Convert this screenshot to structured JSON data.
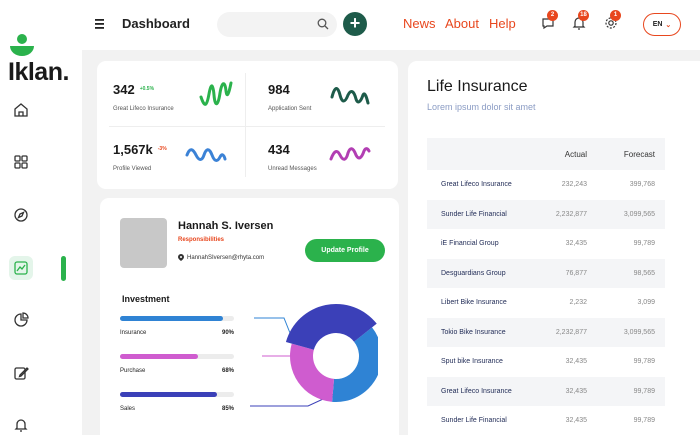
{
  "brand": {
    "name": "Iklan."
  },
  "header": {
    "title": "Dashboard",
    "links": [
      "News",
      "About",
      "Help"
    ],
    "notifications": [
      {
        "icon": "chat-icon",
        "count": "2"
      },
      {
        "icon": "bell-icon",
        "count": "18"
      },
      {
        "icon": "gear-icon",
        "count": "1"
      }
    ],
    "language": "EN"
  },
  "sidebar": {
    "items": [
      {
        "icon": "home-icon"
      },
      {
        "icon": "apps-icon"
      },
      {
        "icon": "compass-icon"
      },
      {
        "icon": "chart-icon",
        "active": true
      },
      {
        "icon": "pie-chart-icon"
      },
      {
        "icon": "edit-icon"
      },
      {
        "icon": "bell-icon"
      }
    ]
  },
  "stats": [
    {
      "value": "342",
      "change": "+0.5%",
      "change_color": "#2bb24c",
      "label": "Great Lifeco Insurance",
      "wave_color": "#2bb24c"
    },
    {
      "value": "984",
      "label": "Application Sent",
      "wave_color": "#1e5b4a"
    },
    {
      "value": "1,567k",
      "change": "-3%",
      "change_color": "#e8471e",
      "label": "Profile Viewed",
      "wave_color": "#3b82d6"
    },
    {
      "value": "434",
      "label": "Unread Messages",
      "wave_color": "#b23eb3"
    }
  ],
  "profile": {
    "name": "Hannah S. Iversen",
    "role": "Responsibilities",
    "email": "HannahSIversen@rhyta.com",
    "button": "Update Profile"
  },
  "investment": {
    "title": "Investment",
    "bars": [
      {
        "label": "Insurance",
        "percent_text": "90%",
        "value": 0.9,
        "color": "#2f83d4"
      },
      {
        "label": "Purchase",
        "percent_text": "68%",
        "value": 0.68,
        "color": "#cf5ccf"
      },
      {
        "label": "Sales",
        "percent_text": "85%",
        "value": 0.85,
        "color": "#3b40b8"
      }
    ]
  },
  "insurance": {
    "title": "Life Insurance",
    "subtitle": "Lorem ipsum dolor sit amet",
    "columns": [
      "Actual",
      "Forecast"
    ],
    "rows": [
      {
        "name": "Great Lifeco Insurance",
        "actual": "232,243",
        "forecast": "399,768"
      },
      {
        "name": "Sunder Life Financial",
        "actual": "2,232,877",
        "forecast": "3,099,565"
      },
      {
        "name": "iE Financial Group",
        "actual": "32,435",
        "forecast": "99,789"
      },
      {
        "name": "Desguardians Group",
        "actual": "76,877",
        "forecast": "98,565"
      },
      {
        "name": "Libert Bike Insurance",
        "actual": "2,232",
        "forecast": "3,099"
      },
      {
        "name": "Tokio Bike Insurance",
        "actual": "2,232,877",
        "forecast": "3,099,565"
      },
      {
        "name": "Sput bike Insurance",
        "actual": "32,435",
        "forecast": "99,789"
      },
      {
        "name": "Great Lifeco Insurance",
        "actual": "32,435",
        "forecast": "99,789"
      },
      {
        "name": "Sunder Life Financial",
        "actual": "32,435",
        "forecast": "99,789"
      }
    ]
  }
}
